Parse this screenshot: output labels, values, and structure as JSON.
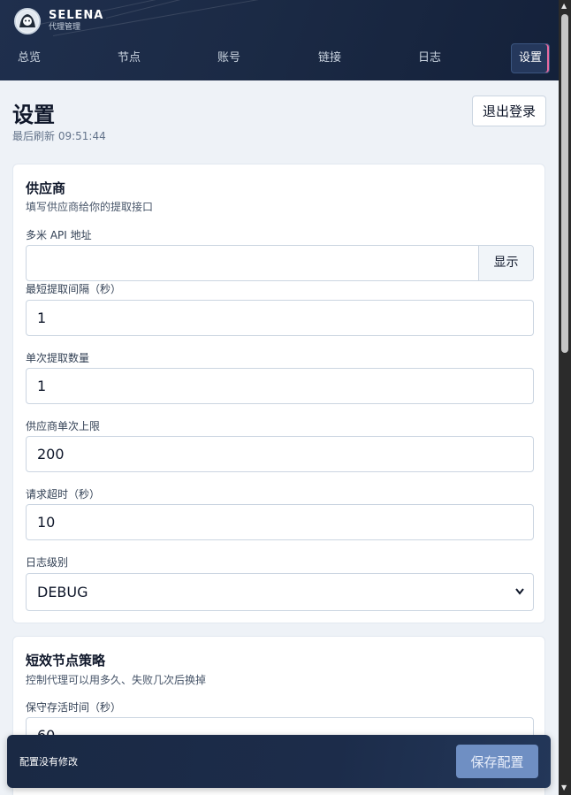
{
  "app": {
    "brand_name": "SELENA",
    "brand_sub": "代理管理"
  },
  "nav": {
    "items": [
      {
        "label": "总览",
        "active": false
      },
      {
        "label": "节点",
        "active": false
      },
      {
        "label": "账号",
        "active": false
      },
      {
        "label": "链接",
        "active": false
      },
      {
        "label": "日志",
        "active": false
      },
      {
        "label": "设置",
        "active": true
      }
    ]
  },
  "page": {
    "title": "设置",
    "last_refresh": "最后刷新 09:51:44",
    "logout_label": "退出登录"
  },
  "provider_card": {
    "title": "供应商",
    "description": "填写供应商给你的提取接口",
    "fields": [
      {
        "label": "多米 API 地址",
        "value": "",
        "button": "显示"
      },
      {
        "label": "最短提取间隔（秒）",
        "value": "1"
      },
      {
        "label": "单次提取数量",
        "value": "1"
      },
      {
        "label": "供应商单次上限",
        "value": "200"
      },
      {
        "label": "请求超时（秒）",
        "value": "10"
      },
      {
        "label": "日志级别",
        "value": "DEBUG",
        "options": [
          "DEBUG"
        ]
      }
    ]
  },
  "strategy_card": {
    "title": "短效节点策略",
    "description": "控制代理可以用多久、失败几次后换掉",
    "fields": [
      {
        "label": "保守存活时间（秒）",
        "value": "60"
      }
    ]
  },
  "savebar": {
    "status": "配置没有修改",
    "save_label": "保存配置"
  },
  "colors": {
    "header_bg": "#1b2a45",
    "accent": "#6f8fc3",
    "active_tab_marker": "#e86aa0",
    "card_bg": "#ffffff",
    "page_bg": "#eef2f7"
  }
}
